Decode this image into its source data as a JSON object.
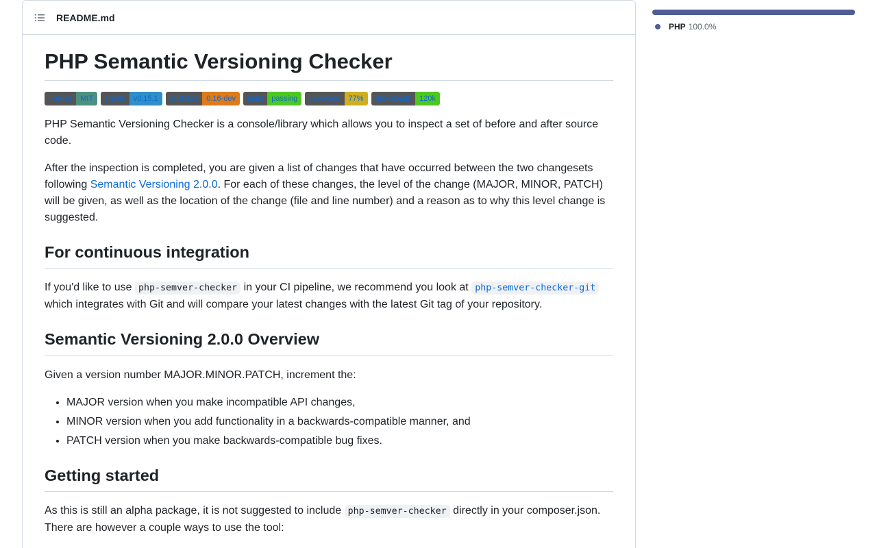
{
  "readme": {
    "filename": "README.md",
    "title": "PHP Semantic Versioning Checker",
    "badges": [
      {
        "label": "license",
        "value": "MIT",
        "color": "#4c9080"
      },
      {
        "label": "stable",
        "value": "v0.15.1",
        "color": "#2f8fc6"
      },
      {
        "label": "unstable",
        "value": "0.16-dev",
        "color": "#dd7a1a"
      },
      {
        "label": "build",
        "value": "passing",
        "color": "#4ec820"
      },
      {
        "label": "coverage",
        "value": "77%",
        "color": "#cfae22"
      },
      {
        "label": "downloads",
        "value": "120k",
        "color": "#4ec820"
      }
    ],
    "intro": "PHP Semantic Versioning Checker is a console/library which allows you to inspect a set of before and after source code.",
    "para2": {
      "before": "After the inspection is completed, you are given a list of changes that have occurred between the two changesets following ",
      "link": "Semantic Versioning 2.0.0",
      "after": ". For each of these changes, the level of the change (MAJOR, MINOR, PATCH) will be given, as well as the location of the change (file and line number) and a reason as to why this level change is suggested."
    },
    "ci": {
      "heading": "For continuous integration",
      "text1": "If you'd like to use ",
      "code1": "php-semver-checker",
      "text2": " in your CI pipeline, we recommend you look at ",
      "link_code": "php-semver-checker-git",
      "text3": " which integrates with Git and will compare your latest changes with the latest Git tag of your repository."
    },
    "overview": {
      "heading": "Semantic Versioning 2.0.0 Overview",
      "text": "Given a version number MAJOR.MINOR.PATCH, increment the:",
      "items": [
        "MAJOR version when you make incompatible API changes,",
        "MINOR version when you add functionality in a backwards-compatible manner, and",
        "PATCH version when you make backwards-compatible bug fixes."
      ]
    },
    "getting_started": {
      "heading": "Getting started",
      "text1": "As this is still an alpha package, it is not suggested to include ",
      "code": "php-semver-checker",
      "text2": " directly in your composer.json. There are however a couple ways to use the tool:"
    }
  },
  "languages": {
    "items": [
      {
        "name": "PHP",
        "percent": "100.0%",
        "color": "#4f5d95"
      }
    ]
  }
}
